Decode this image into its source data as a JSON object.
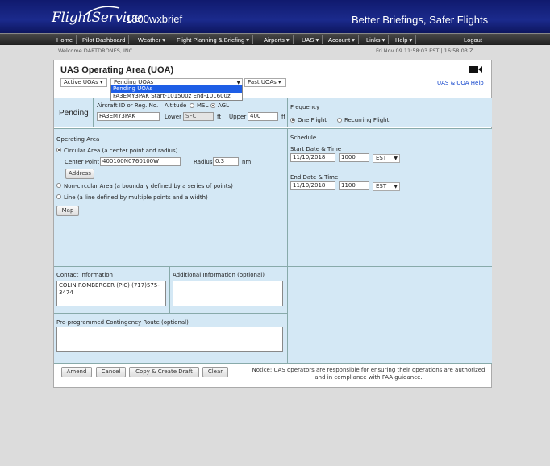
{
  "header": {
    "logo_text": "FlightService",
    "phone": "1800wxbrief",
    "tagline": "Better Briefings, Safer Flights"
  },
  "nav": {
    "items": [
      "Home",
      "Pilot Dashboard",
      "Weather ▾",
      "Flight Planning & Briefing ▾",
      "Airports ▾",
      "UAS ▾",
      "Account ▾",
      "Links ▾",
      "Help ▾"
    ],
    "logout": "Logout"
  },
  "welcome": "Welcome DARTDRONES, INC",
  "datetime": "Fri Nov 09 11:58:03 EST | 16:58:03 Z",
  "page": {
    "title": "UAS Operating Area (UOA)",
    "help_link": "UAS & UOA Help",
    "icons": {
      "camera": "video-camera-icon"
    }
  },
  "uoa_select": {
    "active": "Active UOAs ▾",
    "pending": "Pending UOAs",
    "past": "Past UOAs ▾",
    "dropdown_options": [
      "Pending UOAs",
      "FA3EMY3PAK Start-101500z End-101600z"
    ]
  },
  "status": "Pending",
  "aircraft": {
    "label": "Aircraft ID or Reg. No.",
    "value": "FA3EMY3PAK"
  },
  "altitude": {
    "label": "Altitude",
    "msl": "MSL",
    "agl": "AGL",
    "lower_label": "Lower",
    "lower_value": "SFC",
    "upper_label": "Upper",
    "upper_value": "400",
    "unit": "ft"
  },
  "frequency": {
    "label": "Frequency",
    "one_flight": "One Flight",
    "recurring": "Recurring Flight"
  },
  "operating_area": {
    "label": "Operating Area",
    "circular": "Circular Area (a center point and radius)",
    "center_label": "Center Point",
    "center_value": "400100N0760100W",
    "radius_label": "Radius",
    "radius_value": "0.3",
    "radius_unit": "nm",
    "address_btn": "Address",
    "noncircular": "Non-circular Area (a boundary defined by a series of points)",
    "line": "Line (a line defined by multiple points and a width)",
    "map_btn": "Map"
  },
  "schedule": {
    "label": "Schedule",
    "start_label": "Start Date & Time",
    "start_date": "11/10/2018",
    "start_time": "1000",
    "start_tz": "EST",
    "end_label": "End Date & Time",
    "end_date": "11/10/2018",
    "end_time": "1100",
    "end_tz": "EST"
  },
  "contact": {
    "label": "Contact Information",
    "value": "COLIN ROMBERGER (PIC) (717)575-3474"
  },
  "additional": {
    "label": "Additional Information (optional)",
    "value": ""
  },
  "contingency": {
    "label": "Pre-programmed Contingency Route (optional)",
    "value": ""
  },
  "buttons": {
    "amend": "Amend",
    "cancel": "Cancel",
    "copy": "Copy & Create Draft",
    "clear": "Clear"
  },
  "notice": "Notice: UAS operators are responsible for ensuring their operations are authorized and in compliance with FAA guidance.",
  "colors": {
    "header_bg": "#1b2a8c",
    "section_bg": "#d4e8f5",
    "link": "#1144cc",
    "highlight": "#1e5ee6"
  }
}
